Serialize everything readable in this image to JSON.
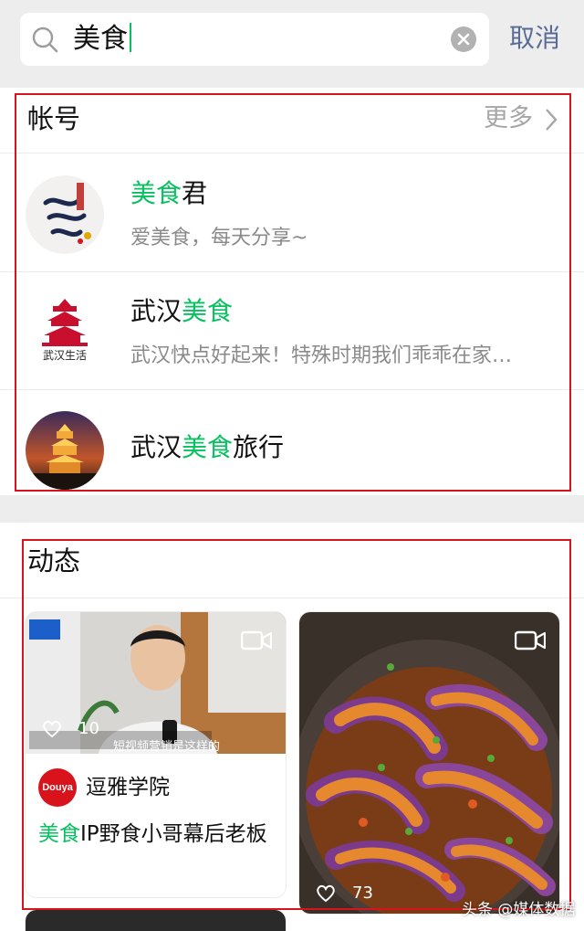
{
  "search": {
    "query": "美食",
    "cancel_label": "取消"
  },
  "accounts_section": {
    "title": "帐号",
    "more_label": "更多",
    "items": [
      {
        "name_highlight": "美食",
        "name_rest": "君",
        "desc": "爱美食，每天分享~"
      },
      {
        "name_prefix": "武汉",
        "name_highlight": "美食",
        "desc": "武汉快点好起来！特殊时期我们乖乖在家…",
        "avatar_caption": "武汉生活"
      },
      {
        "name_prefix": "武汉",
        "name_highlight": "美食",
        "name_rest": "旅行"
      }
    ]
  },
  "feed_section": {
    "title": "动态",
    "cards": [
      {
        "likes": "10",
        "author_logo_text": "Douya",
        "author": "逗雅学院",
        "title_highlight": "美食",
        "title_rest": "IP野食小哥幕后老板",
        "subtitle": "短视频营销是这样的"
      },
      {
        "likes": "73"
      }
    ]
  },
  "watermark": "头条 @媒体数据",
  "colors": {
    "accent": "#07c160",
    "link": "#576b95",
    "annotation_frame": "#d9131c"
  }
}
